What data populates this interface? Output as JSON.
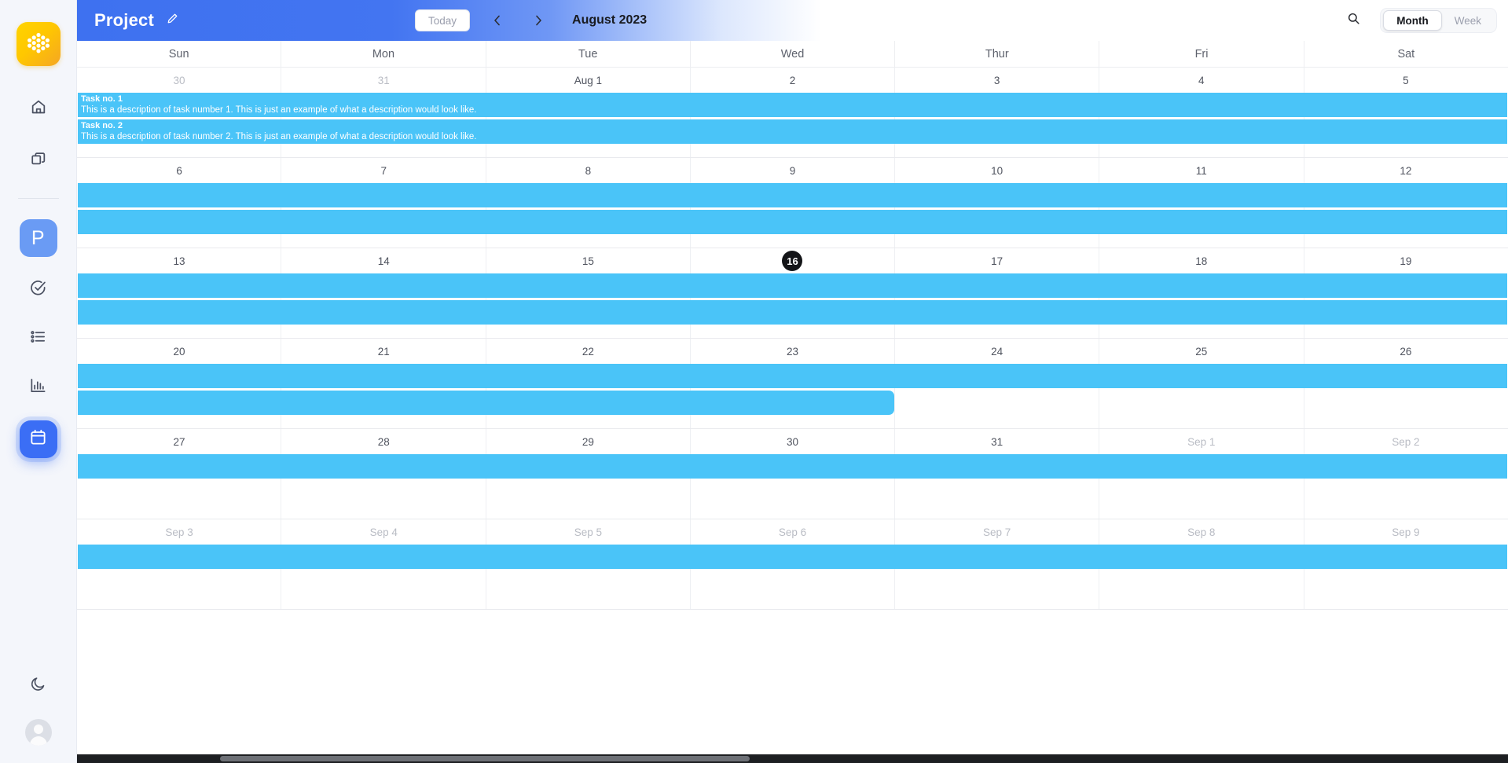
{
  "app": {
    "logo_icon": "honeycomb-logo-icon"
  },
  "sidebar": {
    "top_items": [
      {
        "icon": "home-icon",
        "name": "sidebar-item-home"
      },
      {
        "icon": "copy-icon",
        "name": "sidebar-item-workspaces"
      }
    ],
    "project_avatar": {
      "label": "P",
      "icon": "project-avatar"
    },
    "mid_items": [
      {
        "icon": "check-circle-icon",
        "name": "sidebar-item-tasks"
      },
      {
        "icon": "list-icon",
        "name": "sidebar-item-lists"
      },
      {
        "icon": "bar-chart-icon",
        "name": "sidebar-item-reports"
      },
      {
        "icon": "calendar-icon",
        "name": "sidebar-item-calendar",
        "active": true
      }
    ],
    "bottom_items": [
      {
        "icon": "moon-icon",
        "name": "dark-mode-toggle"
      },
      {
        "icon": "user-avatar-icon",
        "name": "user-avatar"
      }
    ]
  },
  "header": {
    "title": "Project",
    "edit_icon": "pencil-icon",
    "today_label": "Today",
    "prev_icon": "chevron-left-icon",
    "next_icon": "chevron-right-icon",
    "current_period": "August 2023",
    "search_icon": "search-icon",
    "view_options": [
      "Month",
      "Week"
    ],
    "view_selected": "Month",
    "gradient_start": "#3e71f0",
    "gradient_end": "#ffffff"
  },
  "calendar": {
    "day_headers": [
      "Sun",
      "Mon",
      "Tue",
      "Wed",
      "Thur",
      "Fri",
      "Sat"
    ],
    "task_color": "#4ac4f8",
    "today_badge_color": "#141518",
    "weeks": [
      {
        "days": [
          {
            "label": "30",
            "muted": true
          },
          {
            "label": "31",
            "muted": true
          },
          {
            "label": "Aug 1",
            "muted": false
          },
          {
            "label": "2",
            "muted": false
          },
          {
            "label": "3",
            "muted": false
          },
          {
            "label": "4",
            "muted": false
          },
          {
            "label": "5",
            "muted": false
          }
        ],
        "bars": [
          {
            "title": "Task no. 1",
            "description": "This is a description of task number 1. This is just an example of what a description would look like.",
            "start_col": 0,
            "span": 7,
            "continues": true
          },
          {
            "title": "Task no. 2",
            "description": "This is a description of task number 2. This is just an example of what a description would look like.",
            "start_col": 0,
            "span": 7,
            "continues": true
          }
        ]
      },
      {
        "days": [
          {
            "label": "6",
            "muted": false
          },
          {
            "label": "7",
            "muted": false
          },
          {
            "label": "8",
            "muted": false
          },
          {
            "label": "9",
            "muted": false
          },
          {
            "label": "10",
            "muted": false
          },
          {
            "label": "11",
            "muted": false
          },
          {
            "label": "12",
            "muted": false
          }
        ],
        "bars": [
          {
            "title": "",
            "description": "",
            "start_col": 0,
            "span": 7,
            "continues": true
          },
          {
            "title": "",
            "description": "",
            "start_col": 0,
            "span": 7,
            "continues": true
          }
        ]
      },
      {
        "days": [
          {
            "label": "13",
            "muted": false
          },
          {
            "label": "14",
            "muted": false
          },
          {
            "label": "15",
            "muted": false
          },
          {
            "label": "16",
            "muted": false,
            "today": true
          },
          {
            "label": "17",
            "muted": false
          },
          {
            "label": "18",
            "muted": false
          },
          {
            "label": "19",
            "muted": false
          }
        ],
        "bars": [
          {
            "title": "",
            "description": "",
            "start_col": 0,
            "span": 7,
            "continues": true
          },
          {
            "title": "",
            "description": "",
            "start_col": 0,
            "span": 7,
            "continues": true
          }
        ]
      },
      {
        "days": [
          {
            "label": "20",
            "muted": false
          },
          {
            "label": "21",
            "muted": false
          },
          {
            "label": "22",
            "muted": false
          },
          {
            "label": "23",
            "muted": false
          },
          {
            "label": "24",
            "muted": false
          },
          {
            "label": "25",
            "muted": false
          },
          {
            "label": "26",
            "muted": false
          }
        ],
        "bars": [
          {
            "title": "",
            "description": "",
            "start_col": 0,
            "span": 7,
            "continues": true
          },
          {
            "title": "",
            "description": "",
            "start_col": 0,
            "span": 4,
            "continues": false
          }
        ]
      },
      {
        "days": [
          {
            "label": "27",
            "muted": false
          },
          {
            "label": "28",
            "muted": false
          },
          {
            "label": "29",
            "muted": false
          },
          {
            "label": "30",
            "muted": false
          },
          {
            "label": "31",
            "muted": false
          },
          {
            "label": "Sep 1",
            "muted": true
          },
          {
            "label": "Sep 2",
            "muted": true
          }
        ],
        "bars": [
          {
            "title": "",
            "description": "",
            "start_col": 0,
            "span": 7,
            "continues": true
          }
        ]
      },
      {
        "days": [
          {
            "label": "Sep 3",
            "muted": true
          },
          {
            "label": "Sep 4",
            "muted": true
          },
          {
            "label": "Sep 5",
            "muted": true
          },
          {
            "label": "Sep 6",
            "muted": true
          },
          {
            "label": "Sep 7",
            "muted": true
          },
          {
            "label": "Sep 8",
            "muted": true
          },
          {
            "label": "Sep 9",
            "muted": true
          }
        ],
        "bars": [
          {
            "title": "",
            "description": "",
            "start_col": 0,
            "span": 7,
            "continues": true
          }
        ]
      }
    ]
  },
  "scrollbar": {
    "thumb_left_pct": 10,
    "thumb_width_pct": 37
  }
}
